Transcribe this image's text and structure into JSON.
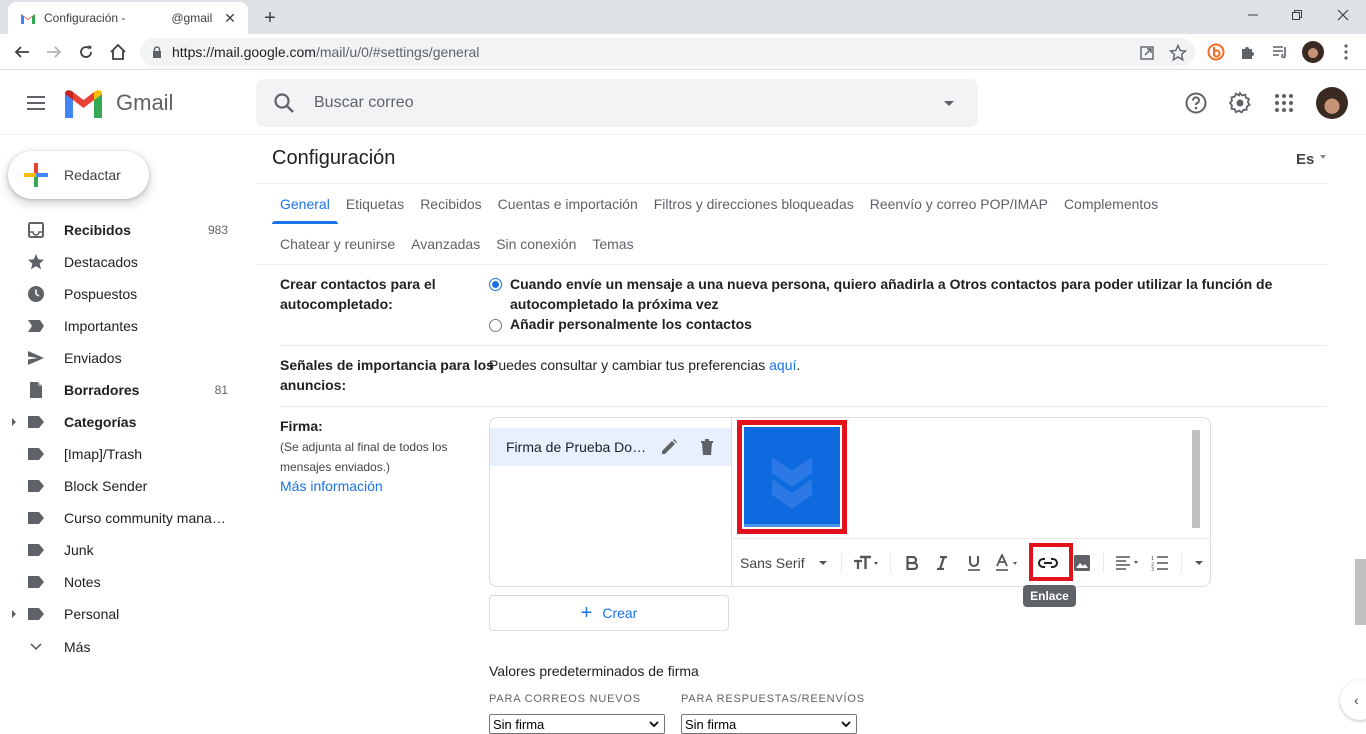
{
  "browser": {
    "tab_title_start": "Configuración -",
    "tab_title_end": "@gmail",
    "url_host": "https://mail.google.com",
    "url_path": "/mail/u/0/#settings/general"
  },
  "header": {
    "app_name": "Gmail",
    "search_placeholder": "Buscar correo"
  },
  "sidebar": {
    "compose_label": "Redactar",
    "items": [
      {
        "label": "Recibidos",
        "count": "983",
        "bold": true,
        "icon": "inbox-icon"
      },
      {
        "label": "Destacados",
        "count": "",
        "bold": false,
        "icon": "star-icon"
      },
      {
        "label": "Pospuestos",
        "count": "",
        "bold": false,
        "icon": "clock-icon"
      },
      {
        "label": "Importantes",
        "count": "",
        "bold": false,
        "icon": "important-icon"
      },
      {
        "label": "Enviados",
        "count": "",
        "bold": false,
        "icon": "send-icon"
      },
      {
        "label": "Borradores",
        "count": "81",
        "bold": true,
        "icon": "draft-icon"
      },
      {
        "label": "Categorías",
        "count": "",
        "bold": true,
        "icon": "label-icon"
      },
      {
        "label": "[Imap]/Trash",
        "count": "",
        "bold": false,
        "icon": "label-icon"
      },
      {
        "label": "Block Sender",
        "count": "",
        "bold": false,
        "icon": "label-icon"
      },
      {
        "label": "Curso community mana…",
        "count": "",
        "bold": false,
        "icon": "label-icon"
      },
      {
        "label": "Junk",
        "count": "",
        "bold": false,
        "icon": "label-icon"
      },
      {
        "label": "Notes",
        "count": "",
        "bold": false,
        "icon": "label-icon"
      },
      {
        "label": "Personal",
        "count": "",
        "bold": false,
        "icon": "label-icon"
      },
      {
        "label": "Más",
        "count": "",
        "bold": false,
        "icon": "chevron-down-icon"
      }
    ]
  },
  "settings": {
    "title": "Configuración",
    "language": "Es",
    "tabs_row1": [
      "General",
      "Etiquetas",
      "Recibidos",
      "Cuentas e importación",
      "Filtros y direcciones bloqueadas",
      "Reenvío y correo POP/IMAP",
      "Complementos"
    ],
    "tabs_row2": [
      "Chatear y reunirse",
      "Avanzadas",
      "Sin conexión",
      "Temas"
    ],
    "active_tab": "General",
    "autocomplete": {
      "label_line1": "Crear contactos para el",
      "label_line2": "autocompletado:",
      "option1_line1": "Cuando envíe un mensaje a una nueva persona, quiero añadirla a Otros contactos para poder utilizar la función de",
      "option1_line2": "autocompletado la próxima vez",
      "option2": "Añadir personalmente los contactos",
      "selected": 1
    },
    "importance": {
      "label_line1": "Señales de importancia para los",
      "label_line2": "anuncios:",
      "text": "Puedes consultar y cambiar tus preferencias ",
      "link": "aquí",
      "text_end": "."
    },
    "signature": {
      "label": "Firma:",
      "desc_line1": "(Se adjunta al final de todos los",
      "desc_line2": "mensajes enviados.)",
      "more_info": "Más información",
      "items": [
        "Firma de Prueba Downloadsource"
      ],
      "font": "Sans Serif",
      "tooltip": "Enlace",
      "create_label": "Crear"
    },
    "defaults": {
      "title": "Valores predeterminados de firma",
      "new_label": "PARA CORREOS NUEVOS",
      "reply_label": "PARA RESPUESTAS/REENVÍOS",
      "new_value": "Sin firma",
      "reply_value": "Sin firma"
    }
  },
  "colors": {
    "accent": "#1a73e8",
    "highlight": "#e3111b",
    "signature_image": "#0d6adf"
  }
}
